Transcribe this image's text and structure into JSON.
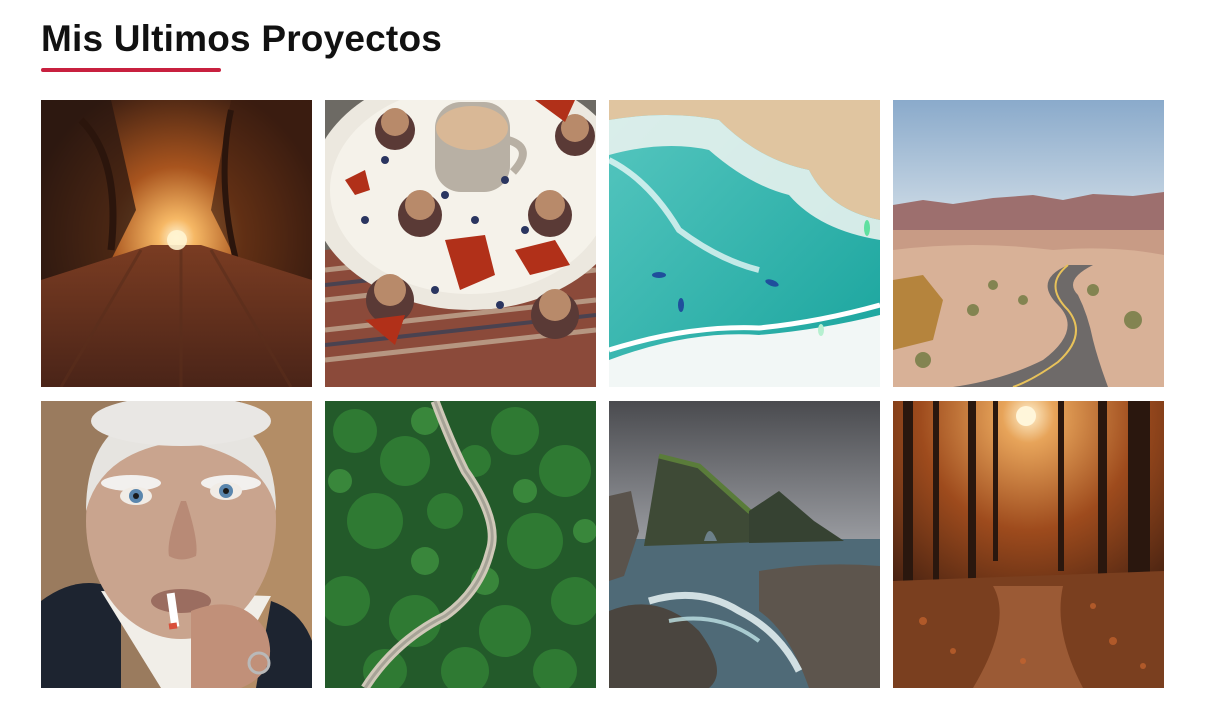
{
  "section": {
    "title": "Mis Ultimos Proyectos",
    "accent_color": "#c8203f"
  },
  "gallery": {
    "items": [
      {
        "subject": "autumn forest road with light at end of tunnel of trees"
      },
      {
        "subject": "tray with coffee cup, chocolate cupcakes, blueberries and red maple leaves"
      },
      {
        "subject": "aerial view of turquoise sea, sandy shore, waves and kayaks"
      },
      {
        "subject": "desert canyon road winding between red rock formations"
      },
      {
        "subject": "portrait of elderly man with white hair smoking a cigarette"
      },
      {
        "subject": "aerial view of green forest with a winding river"
      },
      {
        "subject": "sea stack rock arch with cliffs and rushing waves"
      },
      {
        "subject": "autumn forest path with sun shining through trees"
      }
    ]
  }
}
